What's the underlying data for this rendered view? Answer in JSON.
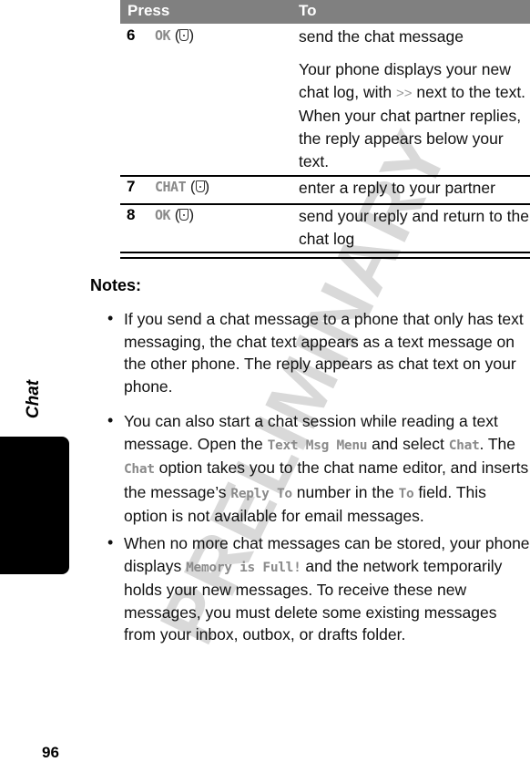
{
  "watermark": "PRELIMINARY",
  "section_label": "Chat",
  "page_number": "96",
  "table": {
    "headers": {
      "press": "Press",
      "to": "To"
    },
    "rows": [
      {
        "step": "6",
        "key_label": "OK",
        "key_icon": "center-select-key-icon",
        "action": "send the chat message",
        "extra_before": "Your phone displays your new chat log, with ",
        "extra_symbol": ">>",
        "extra_after": " next to the text. When your chat partner replies, the reply appears below your text."
      },
      {
        "step": "7",
        "key_label": "CHAT",
        "key_icon": "center-select-key-icon",
        "action": "enter a reply to your partner"
      },
      {
        "step": "8",
        "key_label": "OK",
        "key_icon": "center-select-key-icon",
        "action": "send your reply and return to the chat log"
      }
    ]
  },
  "notes": {
    "title": "Notes:",
    "bullet_glyph": "•",
    "items": [
      {
        "text": "If you send a chat message to a phone that only has text messaging, the chat text appears as a text message on the other phone. The reply appears as chat text on your phone."
      },
      {
        "p1": "You can also start a chat session while reading a text message. Open the ",
        "ui1": "Text Msg Menu",
        "p2": " and select ",
        "ui2": "Chat",
        "p3": ". The ",
        "ui3": "Chat",
        "p4": " option takes you to the chat name editor, and inserts the message’s ",
        "ui4": "Reply To",
        "p5": " number in the ",
        "ui5": "To",
        "p6": " field. This option is not available for email messages."
      },
      {
        "p1": "When no more chat messages can be stored, your phone displays ",
        "ui1": "Memory is Full!",
        "p2": " and the network temporarily holds your new messages. To receive these new messages, you must delete some existing messages from your inbox, outbox, or drafts folder."
      }
    ]
  }
}
